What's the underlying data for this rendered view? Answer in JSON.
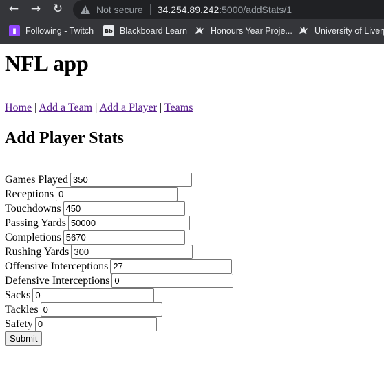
{
  "browser": {
    "security_label": "Not secure",
    "url_host": "34.254.89.242",
    "url_rest": ":5000/addStats/1",
    "bookmarks": [
      {
        "label": "Following - Twitch",
        "icon": "twitch-icon"
      },
      {
        "label": "Blackboard Learn",
        "icon": "blackboard-icon",
        "icon_text": "Bb"
      },
      {
        "label": "Honours Year Proje...",
        "icon": "liverbird-icon"
      },
      {
        "label": "University of Liverp",
        "icon": "liverbird-icon"
      }
    ]
  },
  "page": {
    "title": "NFL app",
    "nav": [
      {
        "label": "Home"
      },
      {
        "label": "Add a Team"
      },
      {
        "label": "Add a Player"
      },
      {
        "label": "Teams"
      }
    ],
    "nav_separator": "|",
    "heading": "Add Player Stats",
    "fields": [
      {
        "label": "Games Played",
        "value": "350"
      },
      {
        "label": "Receptions",
        "value": "0"
      },
      {
        "label": "Touchdowns",
        "value": "450"
      },
      {
        "label": "Passing Yards",
        "value": "50000"
      },
      {
        "label": "Completions",
        "value": "5670"
      },
      {
        "label": "Rushing Yards",
        "value": "300"
      },
      {
        "label": "Offensive Interceptions",
        "value": "27"
      },
      {
        "label": "Defensive Interceptions",
        "value": "0"
      },
      {
        "label": "Sacks",
        "value": "0"
      },
      {
        "label": "Tackles",
        "value": "0"
      },
      {
        "label": "Safety",
        "value": "0"
      }
    ],
    "submit_label": "Submit"
  },
  "colors": {
    "chrome_bg": "#35363a",
    "omnibox_bg": "#202124",
    "visited_link": "#551a8b"
  }
}
